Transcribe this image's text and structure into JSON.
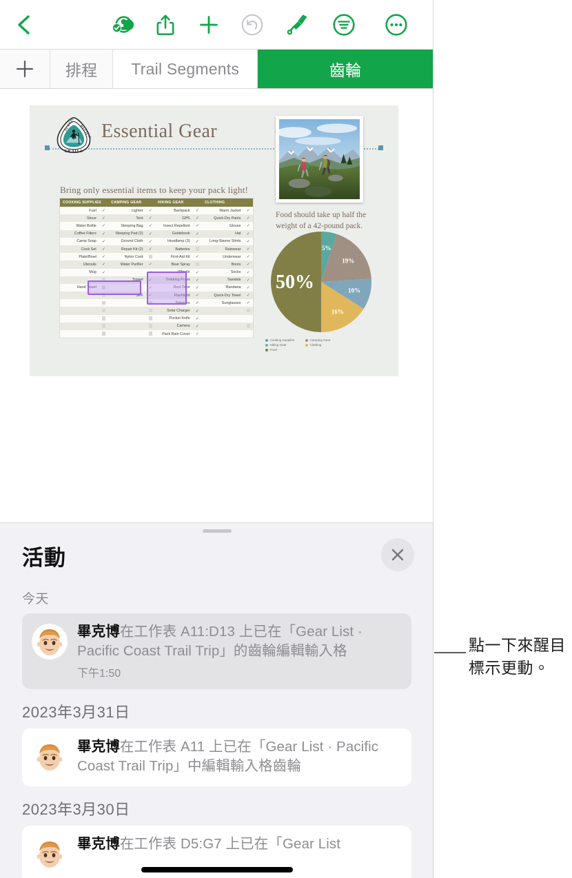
{
  "toolbar": {
    "back_label": "返回",
    "items": [
      {
        "name": "back-icon",
        "label": "返回",
        "color": "#13a54a"
      },
      {
        "name": "collaborate-icon",
        "label": "共同合作",
        "color": "#13a54a"
      },
      {
        "name": "share-icon",
        "label": "分享",
        "color": "#13a54a"
      },
      {
        "name": "insert-icon",
        "label": "插入",
        "color": "#13a54a"
      },
      {
        "name": "undo-icon",
        "label": "還原",
        "color": "#c7c7cc"
      },
      {
        "name": "format-brush-icon",
        "label": "格式",
        "color": "#13a54a"
      },
      {
        "name": "organize-icon",
        "label": "整理",
        "color": "#13a54a"
      },
      {
        "name": "more-icon",
        "label": "更多",
        "color": "#13a54a"
      }
    ]
  },
  "tabbar": {
    "add_label": "+",
    "tabs": [
      {
        "label": "排程",
        "active": false
      },
      {
        "label": "Trail Segments",
        "active": false
      },
      {
        "label": "齒輪",
        "active": true
      }
    ],
    "active_color": "#13a54a"
  },
  "sheet": {
    "logo_text_top": "SCENIC",
    "logo_text_right": "PACIFIC",
    "logo_text_bottom": "TRAILS",
    "title": "Essential Gear",
    "subtitle": "Bring only essential items to keep your pack light!",
    "photo_caption": "Food should take up half the weight of a 42-pound pack.",
    "title_color": "#7c6a5d"
  },
  "gear_table": {
    "headers": [
      "COOKING SUPPLIES",
      "CAMPING GEAR",
      "HIKING GEAR",
      "CLOTHING"
    ],
    "header_bg": "#817f46",
    "rows": [
      {
        "cooking": "Fuel",
        "cooking_chk": "check",
        "camping": "Lighter",
        "camping_chk": "check",
        "hiking": "Backpack",
        "hiking_chk": "check",
        "clothing": "Warm Jacket",
        "clothing_chk": "check"
      },
      {
        "cooking": "Stove",
        "cooking_chk": "check",
        "camping": "Tent",
        "camping_chk": "check",
        "hiking": "GPS",
        "hiking_chk": "check",
        "clothing": "Quick-Dry Pants",
        "clothing_chk": "check"
      },
      {
        "cooking": "Water Bottle",
        "cooking_chk": "check",
        "camping": "Sleeping Bag",
        "camping_chk": "check",
        "hiking": "Insect Repellent",
        "hiking_chk": "check",
        "clothing": "Gloves",
        "clothing_chk": "check"
      },
      {
        "cooking": "Coffee Filters",
        "cooking_chk": "check",
        "camping": "Sleeping Pad (2)",
        "camping_chk": "check",
        "hiking": "Guidebook",
        "hiking_chk": "check",
        "clothing": "Hat",
        "clothing_chk": "check"
      },
      {
        "cooking": "Camp Soap",
        "cooking_chk": "check",
        "camping": "Ground Cloth",
        "camping_chk": "check",
        "hiking": "Headlamp (3)",
        "hiking_chk": "check",
        "clothing": "Long-Sleeve Shirts",
        "clothing_chk": "check"
      },
      {
        "cooking": "Cook Set",
        "cooking_chk": "check",
        "camping": "Repair Kit (2)",
        "camping_chk": "check",
        "hiking": "Batteries",
        "hiking_chk": "box",
        "clothing": "Rainwear",
        "clothing_chk": "check"
      },
      {
        "cooking": "Plate/Bowl",
        "cooking_chk": "check",
        "camping": "Nylon Cord",
        "camping_chk": "box",
        "hiking": "First-Aid Kit",
        "hiking_chk": "check",
        "clothing": "Underwear",
        "clothing_chk": "check"
      },
      {
        "cooking": "Utensils",
        "cooking_chk": "check",
        "camping": "Water Purifier",
        "camping_chk": "check",
        "hiking": "Bear Spray",
        "hiking_chk": "box",
        "clothing": "Boots",
        "clothing_chk": "check"
      },
      {
        "cooking": "Mug",
        "cooking_chk": "check",
        "camping": "",
        "camping_chk": "check",
        "hiking": "Whistle",
        "hiking_chk": "check",
        "clothing": "Socks",
        "clothing_chk": "check"
      },
      {
        "cooking": "",
        "cooking_chk": "box",
        "camping": "Trowel",
        "camping_chk": "check",
        "hiking": "Trekking Poles",
        "hiking_chk": "check",
        "clothing": "Sandals",
        "clothing_chk": "check"
      },
      {
        "cooking": "Hand Towel",
        "cooking_chk": "box",
        "camping": "",
        "camping_chk": "check",
        "hiking": "Duct Tape",
        "hiking_chk": "check",
        "clothing": "Bandana",
        "clothing_chk": "check"
      },
      {
        "cooking": "",
        "cooking_chk": "box",
        "camping": "SPF",
        "camping_chk": "check",
        "hiking": "Flashlight",
        "hiking_chk": "check",
        "clothing": "Quick-Dry Towel",
        "clothing_chk": "check"
      },
      {
        "cooking": "",
        "cooking_chk": "box",
        "camping": "",
        "camping_chk": "box",
        "hiking": "Toiletries",
        "hiking_chk": "check",
        "clothing": "Sunglasses",
        "clothing_chk": "check"
      },
      {
        "cooking": "",
        "cooking_chk": "box",
        "camping": "",
        "camping_chk": "box",
        "hiking": "Solar Charger",
        "hiking_chk": "check",
        "clothing": "",
        "clothing_chk": "box"
      },
      {
        "cooking": "",
        "cooking_chk": "box",
        "camping": "",
        "camping_chk": "box",
        "hiking": "Pocket Knife",
        "hiking_chk": "check",
        "clothing": "",
        "clothing_chk": ""
      },
      {
        "cooking": "",
        "cooking_chk": "box",
        "camping": "",
        "camping_chk": "box",
        "hiking": "Camera",
        "hiking_chk": "check",
        "clothing": "",
        "clothing_chk": "box"
      },
      {
        "cooking": "",
        "cooking_chk": "box",
        "camping": "",
        "camping_chk": "box",
        "hiking": "Pack Rain Cover",
        "hiking_chk": "check",
        "clothing": "",
        "clothing_chk": ""
      }
    ],
    "selection_color": "#9b5de5",
    "selected_cells": [
      "Hand Towel",
      "Trowel",
      "SPF"
    ]
  },
  "chart_data": {
    "type": "pie",
    "title": "",
    "categories": [
      "Cooking Supplies",
      "Camping Gear",
      "Hiking Gear",
      "Clothing",
      "Food"
    ],
    "values": [
      5,
      19,
      10,
      16,
      50
    ],
    "labels": [
      "5%",
      "19%",
      "10%",
      "16%",
      "50%"
    ],
    "colors": [
      "#5aa8a0",
      "#a09083",
      "#7fa6bb",
      "#e0b75a",
      "#817f46"
    ],
    "legend_position": "bottom",
    "grid": false
  },
  "activity": {
    "title": "活動",
    "close_label": "關閉",
    "groups": [
      {
        "day": "今天",
        "entries": [
          {
            "user": "畢克博",
            "text": "在工作表 A11:D13 上已在「Gear List · Pacific Coast Trail Trip」的齒輪編輯輸入格",
            "time": "下午1:50",
            "selected": true
          }
        ]
      },
      {
        "day": "2023年3月31日",
        "entries": [
          {
            "user": "畢克博",
            "text": "在工作表 A11 上已在「Gear List · Pacific Coast Trail Trip」中編輯輸入格齒輪",
            "time": "",
            "selected": false
          }
        ]
      },
      {
        "day": "2023年3月30日",
        "entries": [
          {
            "user": "畢克博",
            "text": "在工作表 D5:G7 上已在「Gear List",
            "time": "",
            "selected": false
          }
        ]
      }
    ]
  },
  "callout": {
    "text": "點一下來醒目標示更動。"
  }
}
